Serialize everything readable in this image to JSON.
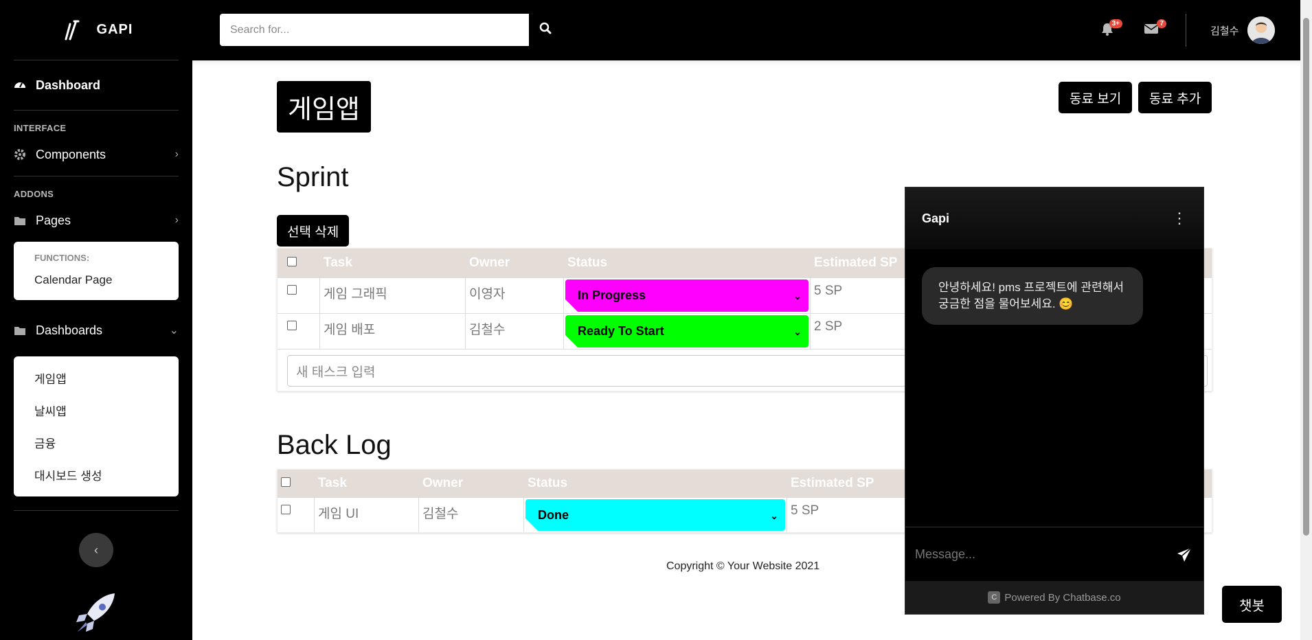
{
  "brand": {
    "name": "GAPI"
  },
  "sidebar": {
    "dashboard_label": "Dashboard",
    "heading_interface": "INTERFACE",
    "components_label": "Components",
    "heading_addons": "ADDONS",
    "pages_label": "Pages",
    "functions_heading": "FUNCTIONS:",
    "calendar_label": "Calendar Page",
    "dashboards_label": "Dashboards",
    "dashboards_items": [
      "게임앱",
      "날씨앱",
      "금융",
      "대시보드 생성"
    ]
  },
  "topbar": {
    "search_placeholder": "Search for...",
    "alerts_badge": "3+",
    "messages_badge": "7",
    "username": "김철수"
  },
  "main": {
    "project_title": "게임앱",
    "view_colleagues": "동료 보기",
    "add_colleague": "동료 추가",
    "sprint_title": "Sprint",
    "delete_selected": "선택 삭제",
    "columns": {
      "task": "Task",
      "owner": "Owner",
      "status": "Status",
      "estimated": "Estimated SP"
    },
    "sprint_rows": [
      {
        "task": "게임 그래픽",
        "owner": "이영자",
        "status": "In Progress",
        "sp": "5 SP"
      },
      {
        "task": "게임 배포",
        "owner": "김철수",
        "status": "Ready To Start",
        "sp": "2 SP"
      }
    ],
    "new_task_placeholder": "새 태스크 입력",
    "backlog_title": "Back Log",
    "backlog_rows": [
      {
        "task": "게임 UI",
        "owner": "김철수",
        "status": "Done",
        "sp": "5 SP"
      }
    ],
    "copyright": "Copyright © Your Website 2021"
  },
  "status_colors": {
    "In Progress": "#ff00ff",
    "Ready To Start": "#00ff00",
    "Done": "#00ffff"
  },
  "chat": {
    "name": "Gapi",
    "greeting": "안녕하세요! pms 프로젝트에 관련해서 궁금한 점을 물어보세요. 😊",
    "input_placeholder": "Message...",
    "powered_by": "Powered By Chatbase.co",
    "powered_logo": "C"
  },
  "chatbot_button": "챗봇"
}
